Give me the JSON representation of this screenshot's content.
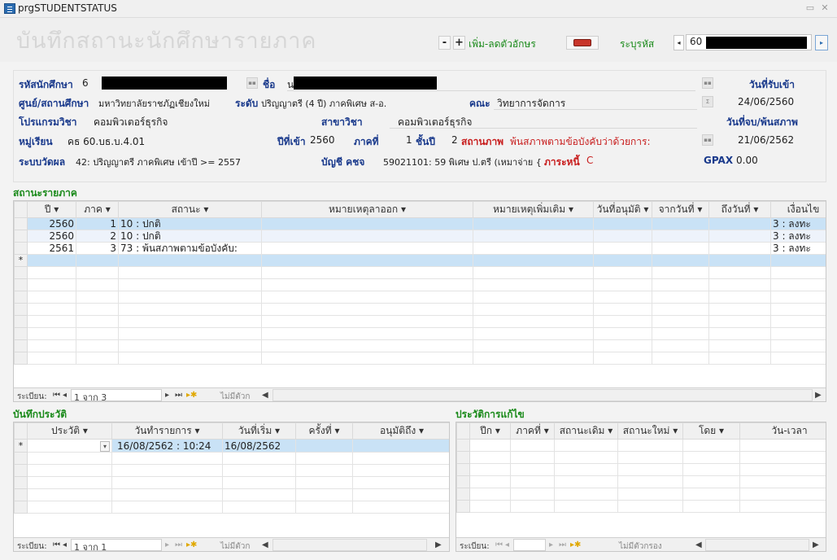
{
  "window": {
    "title": "prgSTUDENTSTATUS"
  },
  "header": {
    "title": "บันทึกสถานะนักศึกษารายภาค",
    "minus_label": "-",
    "plus_label": "+",
    "font_label": "เพิ่ม-ลดตัวอักษร",
    "code_label": "ระบุรหัส",
    "code_value": "60"
  },
  "form": {
    "student_id_label": "รหัสนักศึกษา",
    "student_id_value": "6",
    "name_label": "ชื่อ",
    "name_value": "น",
    "admit_date_label": "วันที่รับเข้า",
    "admit_date_value": "24/06/2560",
    "center_label": "ศูนย์/สถานศึกษา",
    "center_value": "มหาวิทยาลัยราชภัฏเชียงใหม่",
    "level_label": "ระดับ",
    "level_value": "ปริญญาตรี (4 ปี) ภาคพิเศษ ส-อ.",
    "faculty_label": "คณะ",
    "faculty_value": "วิทยาการจัดการ",
    "program_label": "โปรแกรมวิชา",
    "program_value": "คอมพิวเตอร์ธุรกิจ",
    "major_label": "สาขาวิชา",
    "major_value": "คอมพิวเตอร์ธุรกิจ",
    "end_date_label": "วันที่จบ/พ้นสภาพ",
    "end_date_value": "21/06/2562",
    "group_label": "หมู่เรียน",
    "group_value": "คธ 60.บธ.บ.4.01",
    "entry_year_label": "ปีที่เข้า",
    "entry_year_value": "2560",
    "term_label": "ภาคที่",
    "term_value": "1",
    "class_year_label": "ชั้นปี",
    "class_year_value": "2",
    "status_label": "สถานภาพ",
    "status_value": "พ้นสภาพตามข้อบังคับว่าด้วยการ:",
    "eval_label": "ระบบวัดผล",
    "eval_value": "42: ปริญญาตรี ภาคพิเศษ เข้าปี >= 2557",
    "account_label": "บัญชี คชจ",
    "account_value": "59021101: 59 พิเศษ ป.ตรี (เหมาจ่าย {",
    "debt_label": "ภาระหนี้",
    "debt_value": "C",
    "gpax_label": "GPAX",
    "gpax_value": "0.00"
  },
  "term_status": {
    "section_title": "สถานะรายภาค",
    "columns": [
      "ปี",
      "ภาค",
      "สถานะ",
      "หมายเหตุลาออก",
      "หมายเหตุเพิ่มเติม",
      "วันที่อนุมัติ",
      "จากวันที่",
      "ถึงวันที่",
      "เงื่อนไข"
    ],
    "rows": [
      {
        "year": "2560",
        "term": "1",
        "status": "10 : ปกติ",
        "cond": "3 : ลงทะ"
      },
      {
        "year": "2560",
        "term": "2",
        "status": "10 : ปกติ",
        "cond": "3 : ลงทะ"
      },
      {
        "year": "2561",
        "term": "3",
        "status": "73 : พ้นสภาพตามข้อบังคับ:",
        "cond": "3 : ลงทะ"
      }
    ],
    "new_row_marker": "*",
    "nav": {
      "record_label": "ระเบียน:",
      "position": "1 จาก 3",
      "filter_label": "ไม่มีตัวก"
    }
  },
  "history": {
    "section_title": "บันทึกประวัติ",
    "columns": [
      "ประวัติ",
      "วันทำรายการ",
      "วันที่เริ่ม",
      "ครั้งที่",
      "อนุมัติถึง"
    ],
    "new_row": {
      "marker": "*",
      "date": "16/08/2562 : 10:24",
      "start": "16/08/2562"
    },
    "nav": {
      "record_label": "ระเบียน:",
      "position": "1 จาก 1",
      "filter_label": "ไม่มีตัวก"
    }
  },
  "revisions": {
    "section_title": "ประวัติการแก้ไข",
    "columns": [
      "ปีก",
      "ภาคที่",
      "สถานะเดิม",
      "สถานะใหม่",
      "โดย",
      "วัน-เวลา"
    ],
    "nav": {
      "record_label": "ระเบียน:",
      "filter_label": "ไม่มีตัวกรอง"
    }
  }
}
